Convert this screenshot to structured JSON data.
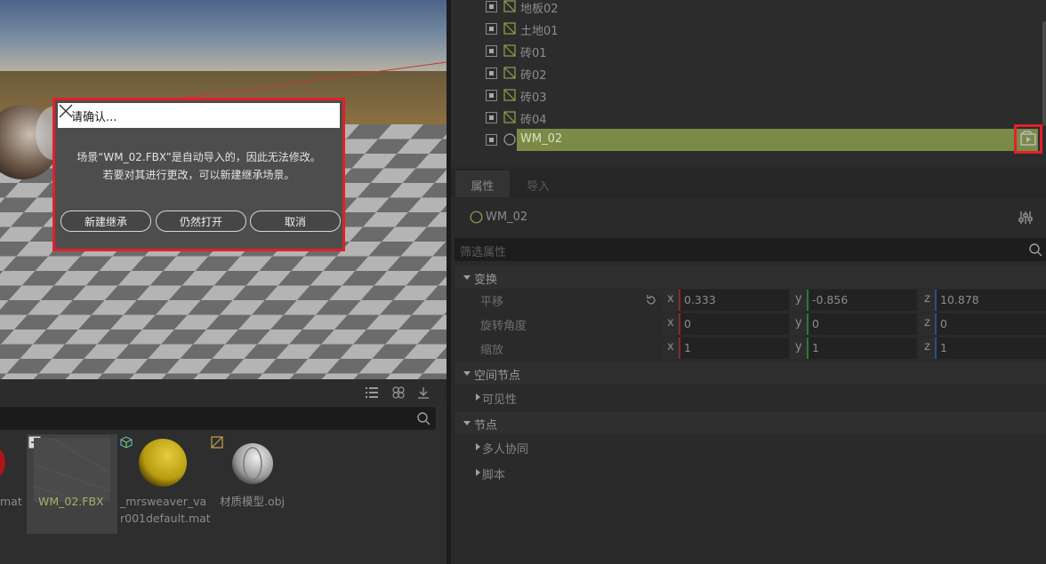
{
  "dialog": {
    "title": "请确认...",
    "message_line1": "场景“WM_02.FBX”是自动导入的，因此无法修改。",
    "message_line2": "若要对其进行更改，可以新建继承场景。",
    "buttons": [
      "新建继承",
      "仍然打开",
      "取消"
    ]
  },
  "assets": {
    "items": [
      {
        "label_lines": [
          "mat"
        ]
      },
      {
        "label_lines": [
          "WM_02.FBX"
        ]
      },
      {
        "label_lines": [
          "_mrsweaver_va",
          "r001default.mat"
        ]
      },
      {
        "label_lines": [
          "材质模型.obj"
        ]
      }
    ]
  },
  "scene_tree": {
    "items": [
      {
        "label": "地板02",
        "type": "mesh"
      },
      {
        "label": "土地01",
        "type": "mesh"
      },
      {
        "label": "砖01",
        "type": "mesh"
      },
      {
        "label": "砖02",
        "type": "mesh"
      },
      {
        "label": "砖03",
        "type": "mesh"
      },
      {
        "label": "砖04",
        "type": "mesh"
      },
      {
        "label": "WM_02",
        "type": "node",
        "selected": true
      }
    ]
  },
  "properties": {
    "tabs": [
      "属性",
      "导入"
    ],
    "active_tab": "属性",
    "object_name": "WM_02",
    "filter_placeholder": "筛选属性",
    "transform": {
      "section": "变换",
      "rows": [
        {
          "label": "平移",
          "x": "0.333",
          "y": "-0.856",
          "z": "10.878"
        },
        {
          "label": "旋转角度",
          "x": "0",
          "y": "0",
          "z": "0"
        },
        {
          "label": "缩放",
          "x": "1",
          "y": "1",
          "z": "1"
        }
      ],
      "axes": [
        "x",
        "y",
        "z"
      ]
    },
    "spatial_node": {
      "section": "空间节点",
      "child": "可见性"
    },
    "node": {
      "section": "节点",
      "children": [
        "多人协同",
        "脚本"
      ]
    }
  },
  "colors": {
    "highlight_red": "#e2202a",
    "tree_selection": "#7c8a48",
    "axis_x": "#8b2a2a",
    "axis_y": "#2f7a33",
    "axis_z": "#2a4f94"
  }
}
